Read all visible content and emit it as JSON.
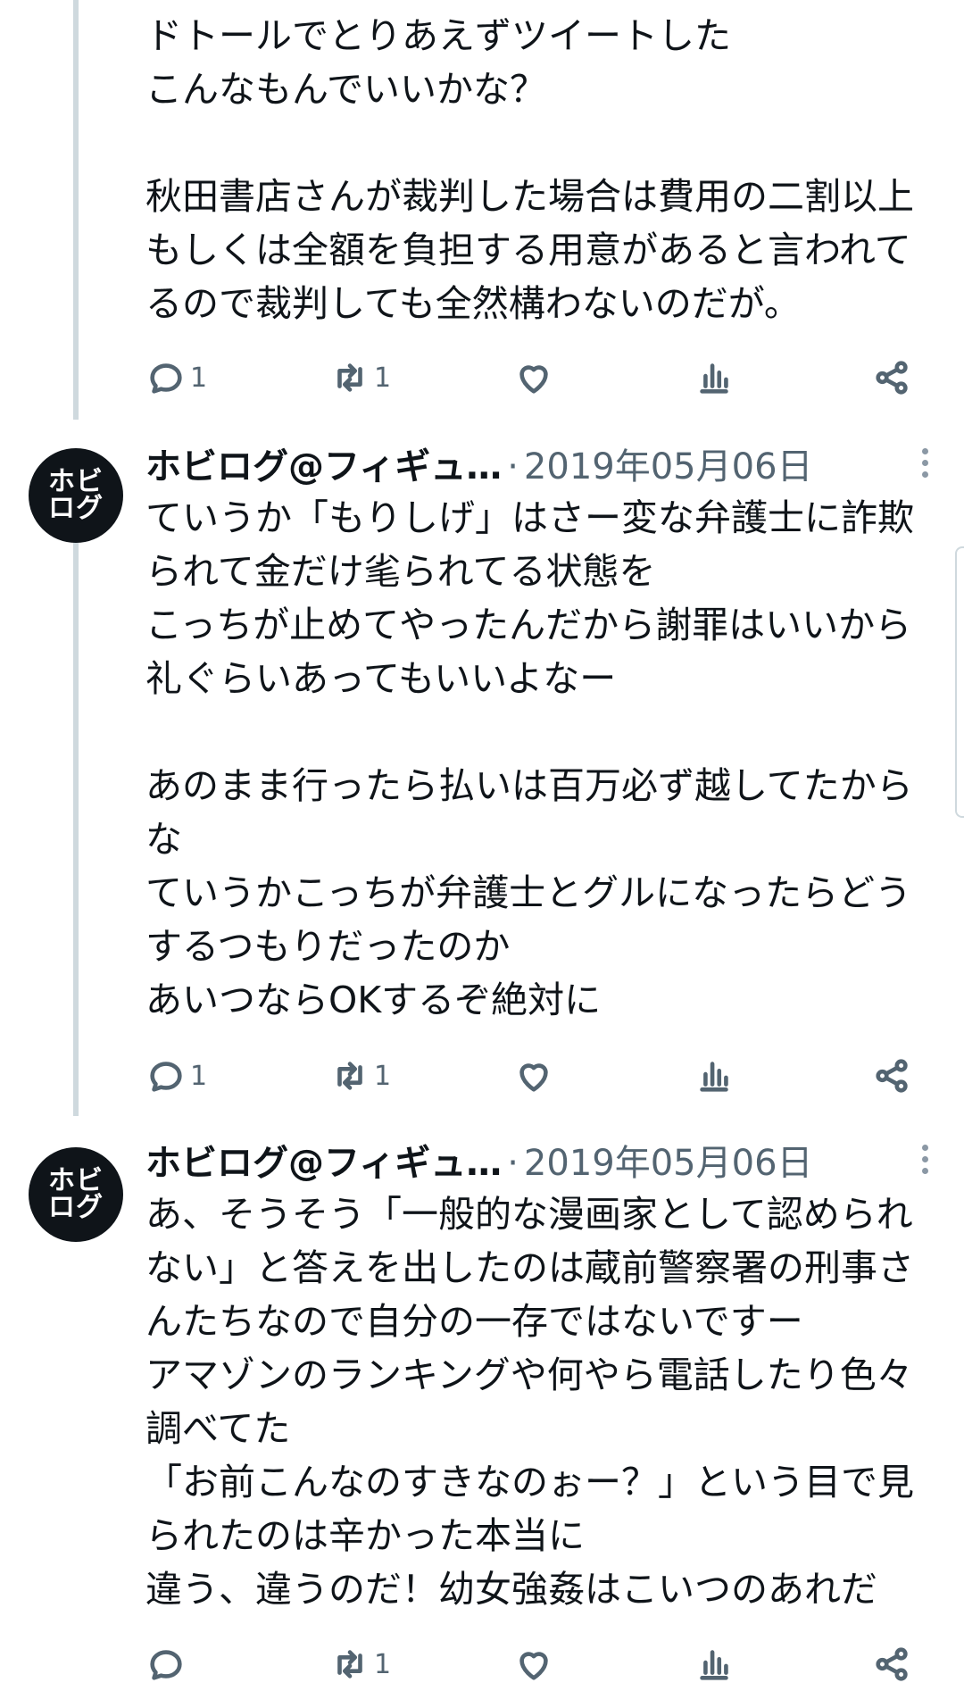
{
  "tweets": [
    {
      "body": "ドトールでとりあえずツイートした\nこんなもんでいいかな？\n\n秋田書店さんが裁判した場合は費用の二割以上もしくは全額を負担する用意があると言われてるので裁判しても全然構わないのだが。",
      "reply_count": "1",
      "retweet_count": "1",
      "like_count": ""
    },
    {
      "author": "ホビログ@フィギュ…",
      "separator": "·",
      "date": "2019年05月06日",
      "avatar_line1": "ホビ",
      "avatar_line2": "ログ",
      "body": "ていうか「もりしげ」はさー変な弁護士に詐欺られて金だけ毟られてる状態を\nこっちが止めてやったんだから謝罪はいいから礼ぐらいあってもいいよなー\n\nあのまま行ったら払いは百万必ず越してたからな\nていうかこっちが弁護士とグルになったらどうするつもりだったのか\nあいつならOKするぞ絶対に",
      "reply_count": "1",
      "retweet_count": "1",
      "like_count": ""
    },
    {
      "author": "ホビログ@フィギュ…",
      "separator": "·",
      "date": "2019年05月06日",
      "avatar_line1": "ホビ",
      "avatar_line2": "ログ",
      "body": "あ、そうそう「一般的な漫画家として認められない」と答えを出したのは蔵前警察署の刑事さんたちなので自分の一存ではないですー\nアマゾンのランキングや何やら電話したり色々調べてた\n「お前こんなのすきなのぉー？」という目で見られたのは辛かった本当に\n違う、違うのだ！幼女強姦はこいつのあれだ",
      "reply_count": "",
      "retweet_count": "1",
      "like_count": ""
    }
  ],
  "icons": {
    "reply": "reply-icon",
    "retweet": "retweet-icon",
    "like": "like-icon",
    "views": "views-icon",
    "share": "share-icon",
    "more": "more-icon"
  },
  "colors": {
    "text": "#0f1419",
    "secondary": "#536471",
    "thread_line": "#cfd9de"
  }
}
